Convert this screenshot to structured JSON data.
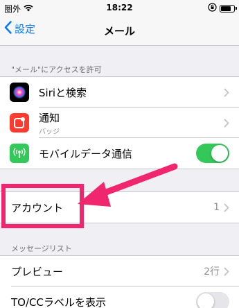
{
  "status_bar": {
    "carrier": "圏外",
    "time": "18:22"
  },
  "nav": {
    "back_label": "設定",
    "title": "メール"
  },
  "section1": {
    "header": "\"メール\"にアクセスを許可",
    "items": [
      {
        "label": "Siriと検索",
        "icon": "siri-icon",
        "color": "#000000"
      },
      {
        "label": "通知",
        "sublabel": "バッジ",
        "icon": "notifications-icon",
        "color": "#ff3b30"
      },
      {
        "label": "モバイルデータ通信",
        "icon": "cellular-icon",
        "color": "#34c759",
        "toggle": "on"
      }
    ]
  },
  "accounts": {
    "label": "アカウント",
    "value": "1"
  },
  "section2": {
    "header": "メッセージリスト",
    "items": [
      {
        "label": "プレビュー",
        "value": "2行"
      },
      {
        "label": "TO/CCラベルを表示",
        "toggle": "off"
      }
    ]
  },
  "colors": {
    "accent": "#007aff",
    "toggle_on": "#34c759",
    "annotation": "#f0266e"
  }
}
